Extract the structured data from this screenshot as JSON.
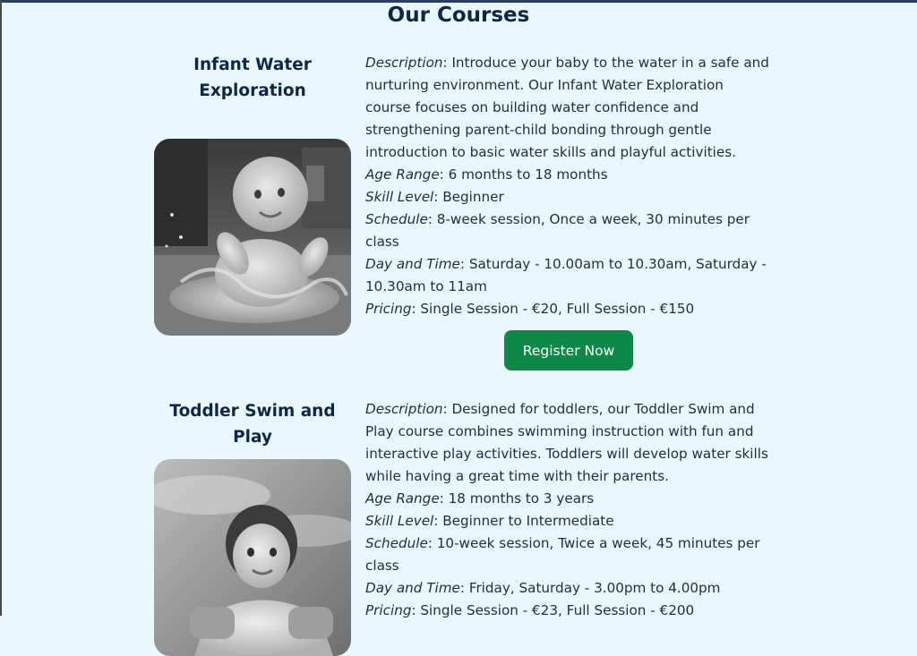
{
  "page": {
    "title": "Our Courses"
  },
  "courses": [
    {
      "title": "Infant Water Exploration",
      "photo_alt": "baby splashing in pool",
      "description_label": "Description",
      "description": "Introduce your baby to the water in a safe and nurturing environment. Our Infant Water Exploration course focuses on building water confidence and strengthening parent-child bonding through gentle introduction to basic water skills and playful activities.",
      "age_label": "Age Range",
      "age": "6 months to 18 months",
      "skill_label": "Skill Level",
      "skill": "Beginner",
      "schedule_label": "Schedule",
      "schedule": "8-week session, Once a week, 30 minutes per class",
      "daytime_label": "Day and Time",
      "daytime": "Saturday - 10.00am to 10.30am, Saturday - 10.30am to 11am",
      "pricing_label": "Pricing",
      "pricing": "Single Session - €20, Full Session - €150",
      "button_label": "Register Now"
    },
    {
      "title": "Toddler Swim and Play",
      "photo_alt": "toddler in swimming pool",
      "description_label": "Description",
      "description": "Designed for toddlers, our Toddler Swim and Play course combines swimming instruction with fun and interactive play activities. Toddlers will develop water skills while having a great time with their parents.",
      "age_label": "Age Range",
      "age": "18 months to 3 years",
      "skill_label": "Skill Level",
      "skill": "Beginner to Intermediate",
      "schedule_label": "Schedule",
      "schedule": "10-week session, Twice a week, 45 minutes per class",
      "daytime_label": "Day and Time",
      "daytime": "Friday, Saturday - 3.00pm to 4.00pm",
      "pricing_label": "Pricing",
      "pricing": "Single Session - €23, Full Session - €200"
    }
  ],
  "colors": {
    "background": "#eaf7fe",
    "heading": "#0d2746",
    "button": "#0e8a48"
  }
}
